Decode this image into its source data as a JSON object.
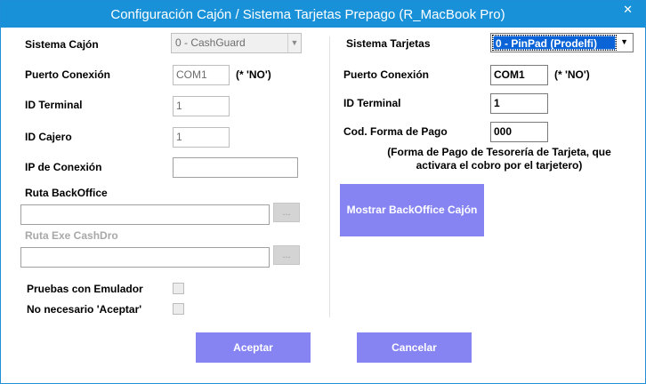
{
  "window": {
    "title": "Configuración Cajón / Sistema Tarjetas Prepago  (R_MacBook Pro)",
    "close_glyph": "✕"
  },
  "left": {
    "sistema_cajon_label": "Sistema Cajón",
    "sistema_cajon_value": "0 - CashGuard",
    "puerto_label": "Puerto Conexión",
    "puerto_value": "COM1",
    "puerto_hint": "(* 'NO')",
    "id_terminal_label": "ID Terminal",
    "id_terminal_value": "1",
    "id_cajero_label": "ID Cajero",
    "id_cajero_value": "1",
    "ip_label": "IP de Conexión",
    "ip_value": "",
    "ruta_backoffice_label": "Ruta BackOffice",
    "ruta_backoffice_value": "",
    "ruta_exe_label": "Ruta Exe CashDro",
    "ruta_exe_value": "",
    "browse_label": "...",
    "pruebas_label": "Pruebas con Emulador",
    "no_aceptar_label": "No necesario 'Aceptar'"
  },
  "right": {
    "sistema_tarjetas_label": "Sistema Tarjetas",
    "sistema_tarjetas_value": "0 - PinPad (Prodelfi)",
    "puerto_label": "Puerto Conexión",
    "puerto_value": "COM1",
    "puerto_hint": "(* 'NO')",
    "id_terminal_label": "ID Terminal",
    "id_terminal_value": "1",
    "forma_pago_label": "Cod. Forma de Pago",
    "forma_pago_value": "000",
    "note_line1": "(Forma de Pago de Tesorería de Tarjeta, que",
    "note_line2": "activara el cobro por el tarjetero)",
    "mostrar_label": "Mostrar BackOffice Cajón"
  },
  "footer": {
    "aceptar_label": "Aceptar",
    "cancelar_label": "Cancelar"
  },
  "icons": {
    "dropdown": "chevron-down-icon",
    "close": "close-icon"
  },
  "colors": {
    "titlebar": "#1891d8",
    "button": "#8684f3",
    "selected": "#0a64d8"
  }
}
